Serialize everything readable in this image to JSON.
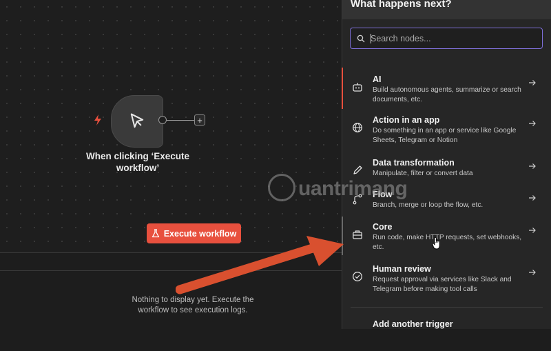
{
  "canvas": {
    "node_label": "When clicking ‘Execute workflow’",
    "add_symbol": "+",
    "execute_button_label": "Execute workflow"
  },
  "logs": {
    "empty_message": "Nothing to display yet. Execute the workflow to see execution logs."
  },
  "panel": {
    "title": "What happens next?",
    "search_placeholder": "Search nodes...",
    "items": [
      {
        "icon": "robot-icon",
        "title": "AI",
        "description": "Build autonomous agents, summarize or search documents, etc."
      },
      {
        "icon": "globe-icon",
        "title": "Action in an app",
        "description": "Do something in an app or service like Google Sheets, Telegram or Notion"
      },
      {
        "icon": "pen-icon",
        "title": "Data transformation",
        "description": "Manipulate, filter or convert data"
      },
      {
        "icon": "branch-icon",
        "title": "Flow",
        "description": "Branch, merge or loop the flow, etc."
      },
      {
        "icon": "toolbox-icon",
        "title": "Core",
        "description": "Run code, make HTTP requests, set webhooks, etc."
      },
      {
        "icon": "check-circle-icon",
        "title": "Human review",
        "description": "Request approval via services like Slack and Telegram before making tool calls"
      },
      {
        "icon": "",
        "title": "Add another trigger",
        "description": ""
      }
    ]
  },
  "watermark": {
    "text": "uantrimang"
  },
  "colors": {
    "accent": "#e8503e",
    "search_border": "#7e6fd9",
    "panel_bg": "#262626",
    "canvas_bg": "#1e1e1e"
  }
}
